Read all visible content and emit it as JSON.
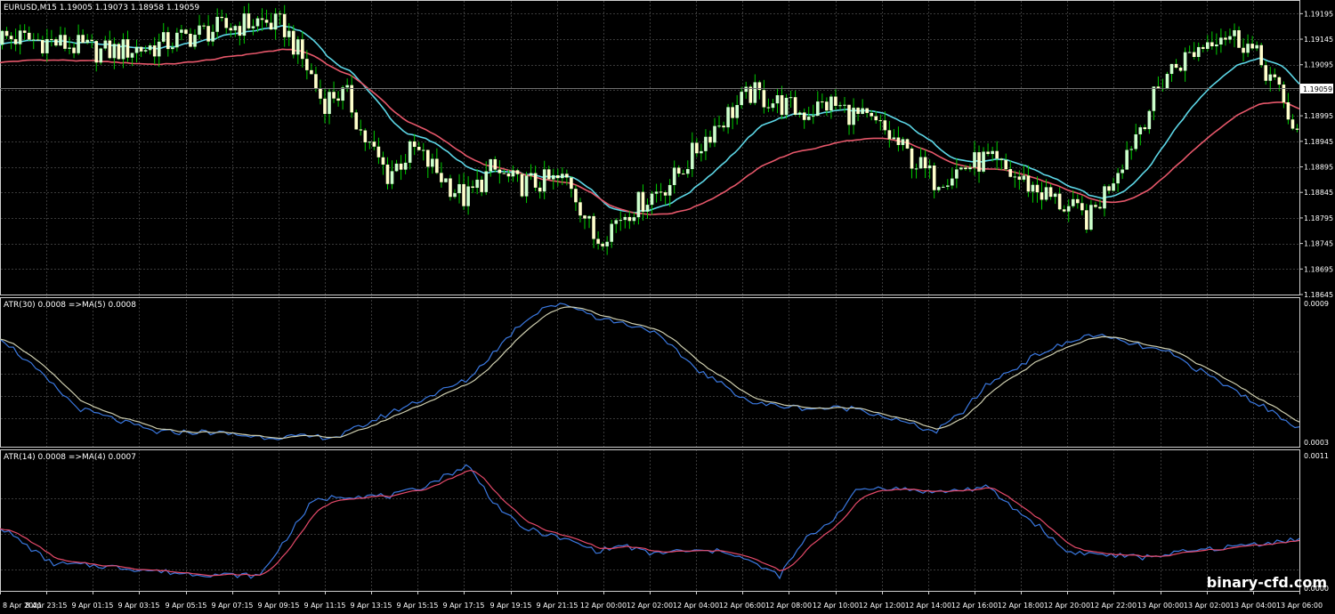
{
  "main_pane": {
    "header": "EURUSD,M15  1.19005 1.19073 1.18958 1.19059",
    "price_ticks": [
      "1.19195",
      "1.19145",
      "1.19095",
      "1.19045",
      "1.18995",
      "1.18945",
      "1.18895",
      "1.18845",
      "1.18795",
      "1.18745",
      "1.18695",
      "1.18645"
    ],
    "current_price_label": "1.19059"
  },
  "atr30_pane": {
    "header": "ATR(30) 0.0008  =>MA(5) 0.0008",
    "ticks": [
      "0.0009",
      "0.0003"
    ]
  },
  "atr14_pane": {
    "header": "ATR(14) 0.0008  =>MA(4) 0.0007",
    "ticks": [
      "0.0011",
      "0.0000"
    ]
  },
  "time_labels": [
    "8 Apr 2021",
    "8 Apr 23:15",
    "9 Apr 01:15",
    "9 Apr 03:15",
    "9 Apr 05:15",
    "9 Apr 07:15",
    "9 Apr 09:15",
    "9 Apr 11:15",
    "9 Apr 13:15",
    "9 Apr 15:15",
    "9 Apr 17:15",
    "9 Apr 19:15",
    "9 Apr 21:15",
    "12 Apr 00:00",
    "12 Apr 02:00",
    "12 Apr 04:00",
    "12 Apr 06:00",
    "12 Apr 08:00",
    "12 Apr 10:00",
    "12 Apr 12:00",
    "12 Apr 14:00",
    "12 Apr 16:00",
    "12 Apr 18:00",
    "12 Apr 20:00",
    "12 Apr 22:00",
    "13 Apr 00:00",
    "13 Apr 02:00",
    "13 Apr 04:00",
    "13 Apr 06:00"
  ],
  "watermark": "binary-cfd.com",
  "colors": {
    "background": "#000000",
    "grid": "#3a3a3a",
    "axis_text": "#ffffff",
    "bull_candle": "#ccffcc",
    "bear_candle": "#ffffcc",
    "wick": "#00cc00",
    "ma_fast": "#e6576a",
    "ma_slow": "#5cd6e6",
    "atr30_line": "#3a78e0",
    "atr30_ma": "#cfcfb0",
    "atr14_line": "#3a78e0",
    "atr14_ma": "#e64a6a"
  },
  "chart_data": [
    {
      "type": "candlestick",
      "title": "EURUSD,M15",
      "ylim": [
        1.18645,
        1.1922
      ],
      "series": [
        {
          "name": "EURUSD,M15",
          "close_path_x": [
            0,
            4,
            8,
            12,
            16,
            20,
            22,
            24,
            25,
            26,
            27,
            28,
            30,
            32,
            36,
            38,
            40,
            44,
            46,
            48,
            52,
            55,
            58,
            62,
            64,
            68,
            70,
            72,
            76,
            80,
            84,
            88,
            90,
            92,
            94,
            96,
            98,
            100
          ],
          "close_path_y": [
            1.1915,
            1.1914,
            1.1912,
            1.1913,
            1.1916,
            1.1918,
            1.1917,
            1.1908,
            1.1902,
            1.1904,
            1.1903,
            1.1896,
            1.1888,
            1.1893,
            1.1883,
            1.1889,
            1.1886,
            1.1887,
            1.1875,
            1.188,
            1.1887,
            1.1897,
            1.1904,
            1.19,
            1.1902,
            1.1897,
            1.1892,
            1.1887,
            1.1891,
            1.1885,
            1.1879,
            1.1898,
            1.1908,
            1.1912,
            1.1916,
            1.1914,
            1.1907,
            1.1896
          ]
        }
      ]
    },
    {
      "type": "line",
      "title": "ATR(30) 0.0008  =>MA(5) 0.0008",
      "ylim": [
        0.0003,
        0.0009
      ],
      "series": [
        {
          "name": "ATR(30)",
          "path_x": [
            0,
            6,
            12,
            16,
            20,
            26,
            30,
            36,
            40,
            42,
            44,
            46,
            50,
            54,
            58,
            62,
            66,
            72,
            74,
            76,
            80,
            84,
            90,
            100
          ],
          "path_y": [
            0.00075,
            0.00045,
            0.00035,
            0.00035,
            0.00033,
            0.00033,
            0.00043,
            0.00057,
            0.0008,
            0.00088,
            0.00088,
            0.00083,
            0.00078,
            0.0006,
            0.00047,
            0.00045,
            0.00045,
            0.00035,
            0.00043,
            0.00055,
            0.00068,
            0.00076,
            0.00068,
            0.00037
          ]
        }
      ]
    },
    {
      "type": "line",
      "title": "ATR(14) 0.0008  =>MA(4) 0.0007",
      "ylim": [
        0.0,
        0.0011
      ],
      "series": [
        {
          "name": "ATR(14)",
          "path_x": [
            0,
            4,
            8,
            10,
            14,
            20,
            24,
            26,
            30,
            32,
            34,
            36,
            38,
            40,
            44,
            46,
            48,
            50,
            52,
            54,
            56,
            60,
            62,
            64,
            66,
            68,
            70,
            72,
            76,
            78,
            80,
            82,
            84,
            88,
            90,
            100
          ],
          "path_y": [
            0.0005,
            0.0002,
            0.00018,
            0.00016,
            0.00012,
            0.0001,
            0.0007,
            0.00075,
            0.00075,
            0.0008,
            0.0009,
            0.001,
            0.0007,
            0.0005,
            0.00038,
            0.0003,
            0.00035,
            0.00028,
            0.0003,
            0.0003,
            0.0003,
            0.0001,
            0.0004,
            0.00055,
            0.0008,
            0.00082,
            0.0008,
            0.00078,
            0.00082,
            0.00065,
            0.0005,
            0.0003,
            0.00028,
            0.00025,
            0.00028,
            0.0004
          ]
        }
      ]
    }
  ]
}
